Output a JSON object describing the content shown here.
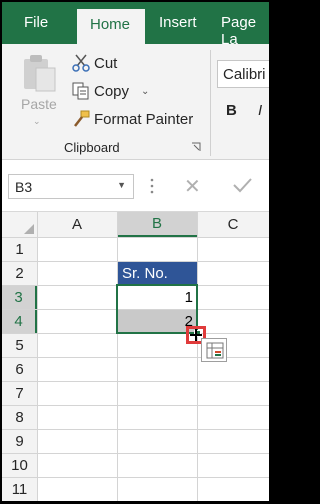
{
  "tabs": {
    "file": "File",
    "home": "Home",
    "insert": "Insert",
    "page_layout": "Page La"
  },
  "ribbon": {
    "paste_label": "Paste",
    "cut_label": "Cut",
    "copy_label": "Copy",
    "format_painter_label": "Format Painter",
    "clipboard_group_label": "Clipboard",
    "font_name": "Calibri",
    "bold_label": "B",
    "italic_label": "I"
  },
  "formula_bar": {
    "name_box": "B3",
    "formula": ""
  },
  "sheet": {
    "columns": [
      "A",
      "B",
      "C"
    ],
    "rows": [
      "1",
      "2",
      "3",
      "4",
      "5",
      "6",
      "7",
      "8",
      "9",
      "10",
      "11"
    ],
    "selected_column": "B",
    "selected_rows": [
      "3",
      "4"
    ],
    "cells": {
      "B2": "Sr. No.",
      "B3": "1",
      "B4": "2"
    }
  },
  "colors": {
    "brand_green": "#217346",
    "header_fill": "#2f5597",
    "highlight_red": "#e03b3b"
  },
  "icons": [
    "paste-icon",
    "cut-icon",
    "copy-icon",
    "format-painter-icon",
    "dialog-launcher-icon",
    "cancel-icon",
    "enter-icon",
    "quick-analysis-icon"
  ]
}
